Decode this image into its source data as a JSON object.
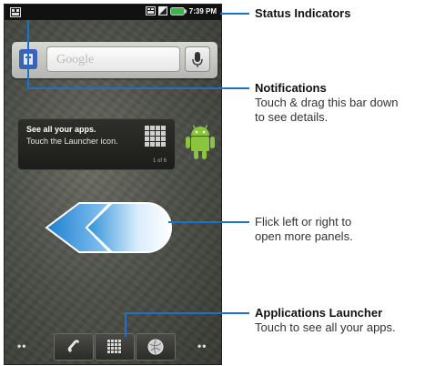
{
  "status_bar": {
    "time": "7:39 PM",
    "icons": [
      "sim-icon",
      "signal-icon",
      "battery-icon"
    ]
  },
  "search_widget": {
    "placeholder": "Google",
    "icons": [
      "google-search-badge-icon",
      "microphone-icon"
    ]
  },
  "tip_bubble": {
    "title": "See all your apps.",
    "body": "Touch the Launcher icon.",
    "page": "1 of 6"
  },
  "dock": {
    "left_dots": "••",
    "right_dots": "••",
    "icons": [
      "phone-icon",
      "launcher-grid-icon",
      "browser-icon"
    ]
  },
  "callouts": {
    "status": {
      "title": "Status Indicators"
    },
    "notifications": {
      "title": "Notifications",
      "line1": "Touch & drag this bar down",
      "line2": "to see details."
    },
    "flick": {
      "line1": "Flick left or right to",
      "line2": "open more panels."
    },
    "launcher": {
      "title": "Applications Launcher",
      "line1": "Touch to see all your apps."
    }
  },
  "colors": {
    "callout_line": "#1a73c8",
    "android_green": "#8bc53f",
    "arrow_blue": "#2a8fd8",
    "battery_green": "#39b54a"
  }
}
